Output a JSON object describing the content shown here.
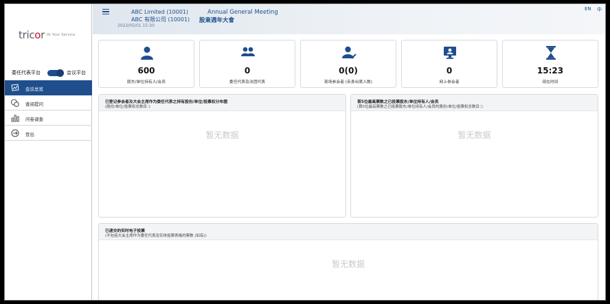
{
  "brand": {
    "logo_text": "tricor",
    "tagline": "At Your Service"
  },
  "sidebar": {
    "toggle": {
      "left_label": "委任代表平台",
      "right_label": "会议平台"
    },
    "items": [
      {
        "label": "会议总览",
        "icon": "monitor-chart-icon",
        "active": true
      },
      {
        "label": "查阅提问",
        "icon": "chat-bubbles-icon",
        "active": false
      },
      {
        "label": "问卷调查",
        "icon": "bar-chart-icon",
        "active": false
      },
      {
        "label": "登出",
        "icon": "logout-icon",
        "active": false
      }
    ]
  },
  "header": {
    "company_en": "ABC Limited  (10001)",
    "company_zh": "ABC 有限公司  (10001)",
    "meeting_en": "Annual General Meeting",
    "meeting_zh": "股東週年大會",
    "datetime": "2022/05/01 15:30",
    "lang_en": "EN",
    "lang_zh": "中"
  },
  "stats": [
    {
      "value": "600",
      "label": "股东/单位持有人/会员",
      "icon": "person-icon"
    },
    {
      "value": "0",
      "label": "委任代表及法团代表",
      "icon": "group-icon"
    },
    {
      "value": "0(0)",
      "label": "现场参会者 (亲身出席人数)",
      "icon": "person-check-icon"
    },
    {
      "value": "0",
      "label": "网上参会者",
      "icon": "online-user-icon"
    },
    {
      "value": "15:23",
      "label": "现在时间",
      "icon": "hourglass-icon"
    }
  ],
  "panels": {
    "proxy_distribution": {
      "title": "已登记参会者及大会主席作为委任代表之持有股份/单位/投票权分布图",
      "subtitle": "(股份/单位/投票权总数目：)",
      "empty": "暂无数据"
    },
    "top_holders": {
      "title": "首5位最高票数之已投票股东/单位持有人/会员",
      "subtitle": "(首5位最高票数之已投票股东/单位持有人/会员的股份/单位/投票权总数目：)",
      "empty": "暂无数据"
    },
    "realtime_voting": {
      "title": "已递交的实时电子投票",
      "subtitle": "(不包括大会主席作为委任代表及实体投票表格的票数 (如有))",
      "empty": "暂无数据"
    }
  },
  "colors": {
    "primary": "#1f4e8c",
    "logo_accent": "#c8102e",
    "empty_text": "#c7c9cc"
  }
}
